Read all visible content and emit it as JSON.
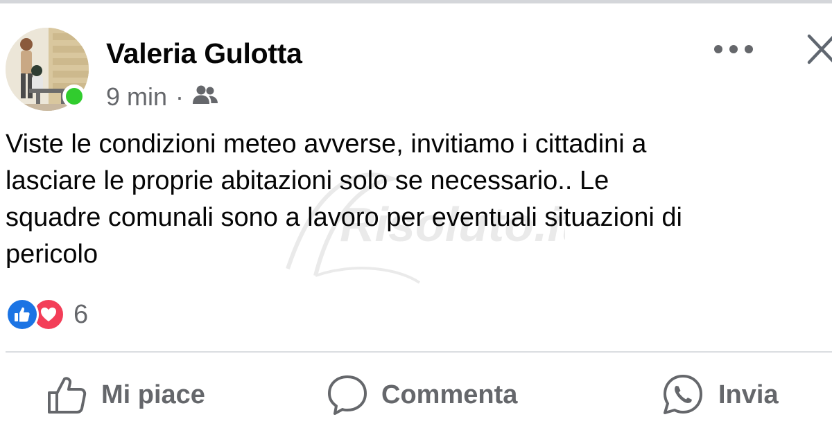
{
  "post": {
    "author": "Valeria Gulotta",
    "time": "9 min",
    "separator": "·",
    "audience_icon": "friends-icon",
    "text": "Viste le condizioni meteo avverse, invitiamo i cittadini a\nlasciare le proprie abitazioni solo se necessario.. Le\nsquadre comunali sono a lavoro per eventuali situazioni di\npericolo",
    "reaction_count": "6",
    "watermark": "Risoluto.it"
  },
  "actions": {
    "like_label": "Mi piace",
    "comment_label": "Commenta",
    "share_label": "Invia"
  },
  "icons": {
    "more": "more-horizontal-icon",
    "close": "close-icon",
    "like": "thumbs-up-icon",
    "comment": "comment-bubble-icon",
    "share": "whatsapp-icon"
  },
  "colors": {
    "text": "#050505",
    "secondary_text": "#65676b",
    "online": "#31cc2e",
    "like_reaction": "#1b74e4",
    "love_reaction": "#f33e58",
    "divider": "#dadde1"
  }
}
